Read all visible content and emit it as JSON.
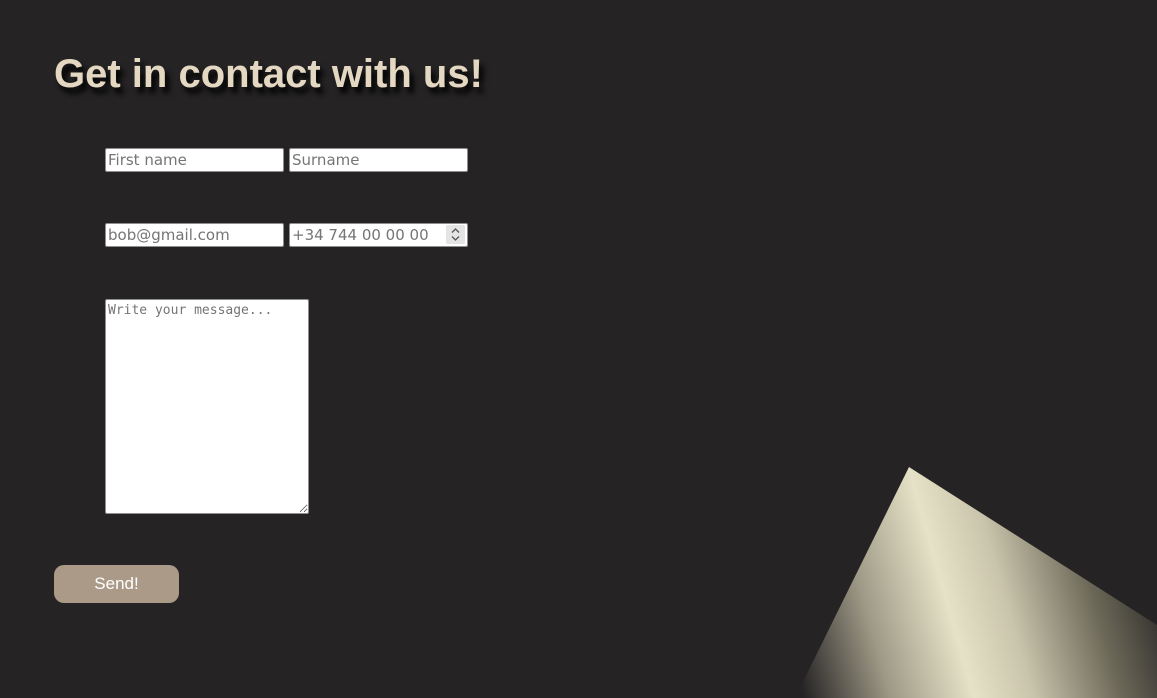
{
  "header": {
    "title": "Get in contact with us!"
  },
  "form": {
    "first_name_placeholder": "First name",
    "surname_placeholder": "Surname",
    "email_placeholder": "bob@gmail.com",
    "phone_placeholder": "+34 744 00 00 00",
    "message_placeholder": "Write your message...",
    "send_label": "Send!"
  },
  "colors": {
    "background": "#252324",
    "title": "#e4d8c2",
    "button": "#ab9a88",
    "beam": "#e4e0c6"
  },
  "icons": {
    "phone_spinner": "chevron-up-down-icon",
    "message_resize": "resize-grip-icon"
  }
}
